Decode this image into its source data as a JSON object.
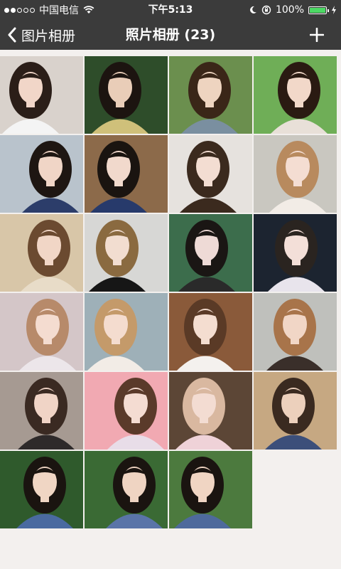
{
  "status_bar": {
    "carrier": "中国电信",
    "time": "下午5:13",
    "battery": "100%",
    "signal_icon": "signal-dots-icon",
    "wifi_icon": "wifi-icon"
  },
  "nav": {
    "back_label": "图片相册",
    "title": "照片相册 (23)",
    "add_icon": "plus-icon"
  },
  "photos": [
    {
      "bg": "#d9d2cc",
      "hair": "#2b1e18",
      "skin": "#f1d6c8",
      "cloth": "#f4f4f4"
    },
    {
      "bg": "#2e4d2a",
      "hair": "#1c1410",
      "skin": "#e9cdb8",
      "cloth": "#cfc07a"
    },
    {
      "bg": "#6b8f4e",
      "hair": "#3a2618",
      "skin": "#eed4c0",
      "cloth": "#7a8fa0"
    },
    {
      "bg": "#6fae57",
      "hair": "#2a1a12",
      "skin": "#f2d8c9",
      "cloth": "#e8e0d8"
    },
    {
      "bg": "#b9c3cc",
      "hair": "#1e1612",
      "skin": "#f0d5c6",
      "cloth": "#2c3d6a"
    },
    {
      "bg": "#8c6a4a",
      "hair": "#1a1410",
      "skin": "#f1d9cc",
      "cloth": "#273a6b"
    },
    {
      "bg": "#e6e2de",
      "hair": "#3b2a1e",
      "skin": "#f3ddd2",
      "cloth": "#3b2a1e"
    },
    {
      "bg": "#c9c7c0",
      "hair": "#b88a5e",
      "skin": "#f4ddd2",
      "cloth": "#f2ece6"
    },
    {
      "bg": "#d8c6a8",
      "hair": "#6b4a30",
      "skin": "#f1d6c6",
      "cloth": "#e8dcc8"
    },
    {
      "bg": "#d7d7d5",
      "hair": "#8a6a40",
      "skin": "#f2ddd0",
      "cloth": "#161616"
    },
    {
      "bg": "#3c6d4c",
      "hair": "#1a1614",
      "skin": "#eedad6",
      "cloth": "#2a2a2a"
    },
    {
      "bg": "#1c2430",
      "hair": "#2a2420",
      "skin": "#f3dfd8",
      "cloth": "#e8e4ec"
    },
    {
      "bg": "#d4c6c8",
      "hair": "#b78a6a",
      "skin": "#f4dcd0",
      "cloth": "#ece6ea"
    },
    {
      "bg": "#9eb0b8",
      "hair": "#c49a6a",
      "skin": "#f4dccf",
      "cloth": "#f2ece6"
    },
    {
      "bg": "#8a5a3a",
      "hair": "#5a3a26",
      "skin": "#f4ddd0",
      "cloth": "#f4f1ee"
    },
    {
      "bg": "#bfc0bc",
      "hair": "#a8744a",
      "skin": "#f1d6c6",
      "cloth": "#3a2f2a"
    },
    {
      "bg": "#a69a92",
      "hair": "#3a2a22",
      "skin": "#f0d4c6",
      "cloth": "#2e2a2a"
    },
    {
      "bg": "#f1a9b2",
      "hair": "#5a3a2a",
      "skin": "#f4dcd2",
      "cloth": "#e8dde8"
    },
    {
      "bg": "#5c4636",
      "hair": "#d9b8a0",
      "skin": "#f3dcd2",
      "cloth": "#efd2d8"
    },
    {
      "bg": "#c6a882",
      "hair": "#3a2a20",
      "skin": "#ecd0bc",
      "cloth": "#3c4f7a"
    },
    {
      "bg": "#2f5a2c",
      "hair": "#1a1410",
      "skin": "#f0d6c4",
      "cloth": "#4a6aa0"
    },
    {
      "bg": "#3a6a34",
      "hair": "#1a1410",
      "skin": "#efd4c2",
      "cloth": "#5a74a8"
    },
    {
      "bg": "#4c7a3e",
      "hair": "#1a1410",
      "skin": "#f0d5c3",
      "cloth": "#4e6a9c"
    }
  ]
}
